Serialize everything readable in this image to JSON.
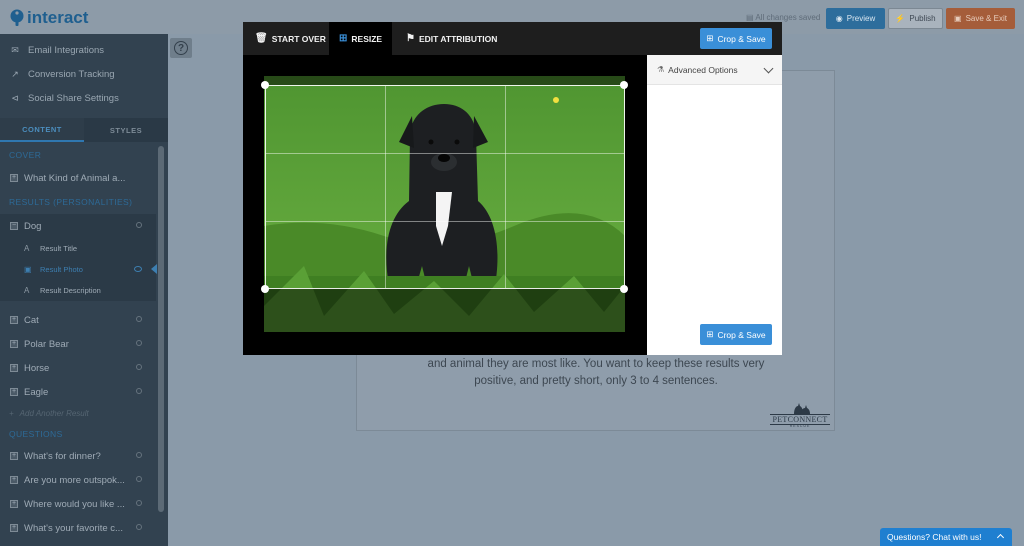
{
  "app": {
    "logo_text": "interact",
    "saved_status": "All changes saved",
    "preview_label": "Preview",
    "publish_label": "Publish",
    "save_exit_label": "Save & Exit"
  },
  "colors": {
    "accent": "#3a8fd8",
    "sidebar_bg": "#324250",
    "save_exit": "#a55d3a",
    "chat": "#1f7fd0"
  },
  "sidebar": {
    "menu": [
      {
        "label": "Email Integrations",
        "icon": "envelope-icon"
      },
      {
        "label": "Conversion Tracking",
        "icon": "chart-line-icon"
      },
      {
        "label": "Social Share Settings",
        "icon": "share-icon"
      }
    ],
    "tabs": [
      {
        "label": "CONTENT",
        "active": true
      },
      {
        "label": "STYLES",
        "active": false
      }
    ],
    "sections": {
      "cover": "COVER",
      "results": "RESULTS (PERSONALITIES)",
      "questions": "QUESTIONS"
    },
    "cover_items": [
      {
        "label": "What Kind of Animal a..."
      }
    ],
    "results": [
      {
        "label": "Dog",
        "expanded": true
      },
      {
        "label": "Cat"
      },
      {
        "label": "Polar Bear"
      },
      {
        "label": "Horse"
      },
      {
        "label": "Eagle"
      }
    ],
    "dog_children": [
      {
        "label": "Result Title",
        "icon": "text-icon"
      },
      {
        "label": "Result Photo",
        "icon": "image-icon",
        "active": true
      },
      {
        "label": "Result Description",
        "icon": "text-icon"
      }
    ],
    "add_result_label": "Add Another Result",
    "questions": [
      {
        "label": "What's for dinner?"
      },
      {
        "label": "Are you more outspok..."
      },
      {
        "label": "Where would you like ..."
      },
      {
        "label": "What's your favorite c..."
      }
    ]
  },
  "canvas": {
    "body_text_line1": "and animal they are most like. You want to keep these results very",
    "body_text_line2": "positive, and pretty short, only 3 to 4 sentences.",
    "brand_logo": "PETCONNECT",
    "brand_sub": "RESCUE"
  },
  "modal": {
    "tabs": [
      {
        "label": "START OVER",
        "icon": "trash-icon"
      },
      {
        "label": "RESIZE",
        "icon": "crop-icon",
        "active": true
      },
      {
        "label": "EDIT ATTRIBUTION",
        "icon": "tag-icon"
      }
    ],
    "crop_save_label": "Crop & Save",
    "advanced_options_label": "Advanced Options"
  },
  "chat": {
    "label": "Questions? Chat with us!"
  }
}
